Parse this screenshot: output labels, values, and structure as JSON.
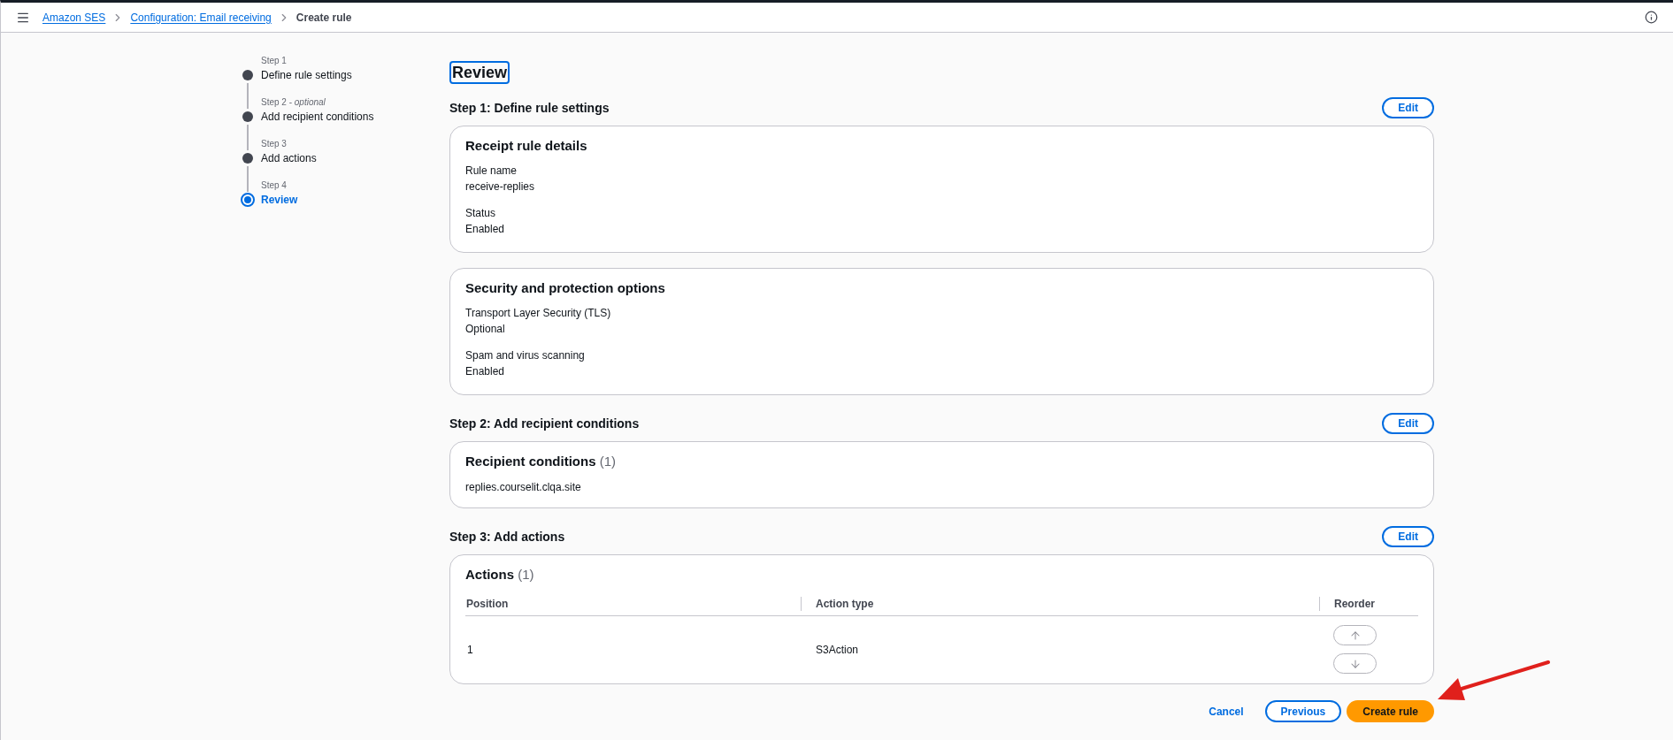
{
  "top_bar": {
    "breadcrumbs": [
      {
        "label": "Amazon SES",
        "kind": "link"
      },
      {
        "label": "Configuration: Email receiving",
        "kind": "link"
      },
      {
        "label": "Create rule",
        "kind": "current"
      }
    ]
  },
  "steps": [
    {
      "caption": "Step 1",
      "label": "Define rule settings",
      "selected": false
    },
    {
      "caption": "Step 2 - *optional*",
      "label": "Add recipient conditions",
      "selected": false
    },
    {
      "caption": "Step 3",
      "label": "Add actions",
      "selected": false
    },
    {
      "caption": "Step 4",
      "label": "Review",
      "selected": true
    }
  ],
  "page_title": {
    "text": "Review",
    "focused": true
  },
  "sections": [
    {
      "heading": "Step 1: Define rule settings",
      "edit_button": "Edit",
      "cards": [
        {
          "kind": "details",
          "title": "Receipt rule details",
          "fields": [
            {
              "label": "Rule name",
              "value": "receive-replies"
            },
            {
              "label": "Status",
              "value": "Enabled"
            }
          ]
        },
        {
          "kind": "details",
          "title": "Security and protection options",
          "fields": [
            {
              "label": "Transport Layer Security (TLS)",
              "value": "Optional"
            },
            {
              "label": "Spam and virus scanning",
              "value": "Enabled"
            }
          ]
        }
      ]
    },
    {
      "heading": "Step 2: Add recipient conditions",
      "edit_button": "Edit",
      "cards": [
        {
          "kind": "list",
          "title": "Recipient conditions",
          "count": "(1)",
          "items": [
            "replies.courselit.clqa.site"
          ]
        }
      ]
    },
    {
      "heading": "Step 3: Add actions",
      "edit_button": "Edit",
      "cards": [
        {
          "kind": "table",
          "title": "Actions",
          "count": "(1)",
          "columns": [
            "Position",
            "Action type",
            "Reorder"
          ],
          "rows": [
            {
              "cells": [
                "1",
                "S3Action"
              ],
              "move_up_disabled": true,
              "move_down_disabled": true
            }
          ]
        }
      ]
    }
  ],
  "footer_buttons": [
    {
      "label": "Cancel",
      "kind": "link"
    },
    {
      "label": "Previous",
      "kind": "normal"
    },
    {
      "label": "Create rule",
      "kind": "primary"
    }
  ]
}
